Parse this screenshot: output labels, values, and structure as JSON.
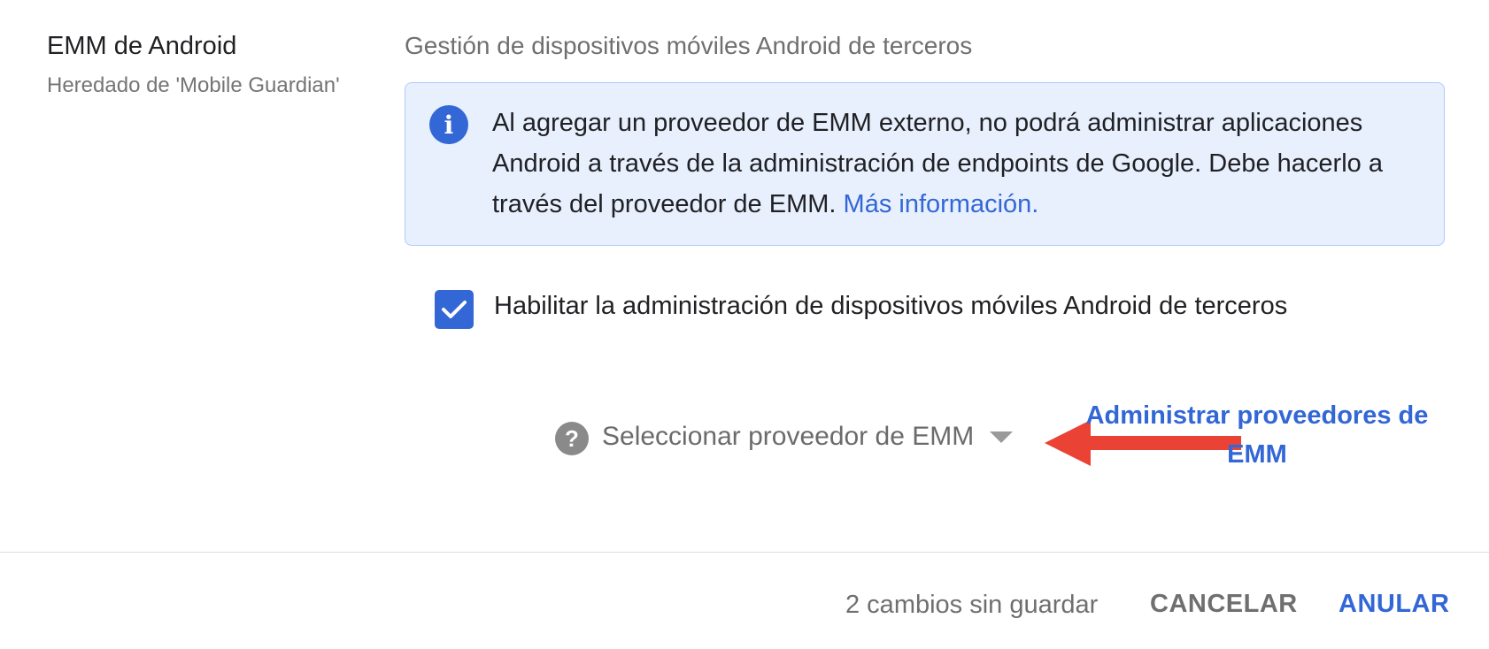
{
  "section": {
    "title": "EMM de Android",
    "inherited": "Heredado de 'Mobile Guardian'"
  },
  "setting": {
    "heading": "Gestión de dispositivos móviles Android de terceros"
  },
  "info": {
    "icon": "info-icon",
    "text": "Al agregar un proveedor de EMM externo, no podrá administrar aplicaciones Android a través de la administración de endpoints de Google. Debe hacerlo a través del proveedor de EMM.",
    "link": "Más información."
  },
  "checkbox": {
    "checked": true,
    "label": "Habilitar la administración de dispositivos móviles Android de terceros"
  },
  "provider_select": {
    "help_icon": "help-icon",
    "value": "Seleccionar proveedor de EMM"
  },
  "annotation": {
    "text": "Administrar proveedores de EMM",
    "arrow_color": "#ea4335"
  },
  "footer": {
    "unsaved": "2 cambios sin guardar",
    "cancel": "CANCELAR",
    "override": "ANULAR"
  },
  "colors": {
    "accent": "#3367d6",
    "info_bg": "#e8f0fe",
    "annotation_arrow": "#ea4335"
  }
}
